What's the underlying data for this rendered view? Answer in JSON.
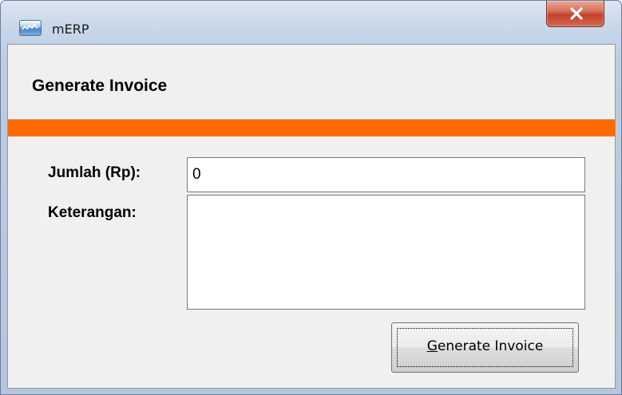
{
  "window": {
    "title": "mERP",
    "icon": "app-icon",
    "close_icon": "close-icon"
  },
  "header": {
    "title": "Generate Invoice",
    "accent_color": "#ff6a00"
  },
  "form": {
    "amount_label": "Jumlah (Rp):",
    "amount_value": "0",
    "description_label": "Keterangan:",
    "description_value": ""
  },
  "actions": {
    "generate_label_mnemonic": "G",
    "generate_label_rest": "enerate Invoice"
  }
}
